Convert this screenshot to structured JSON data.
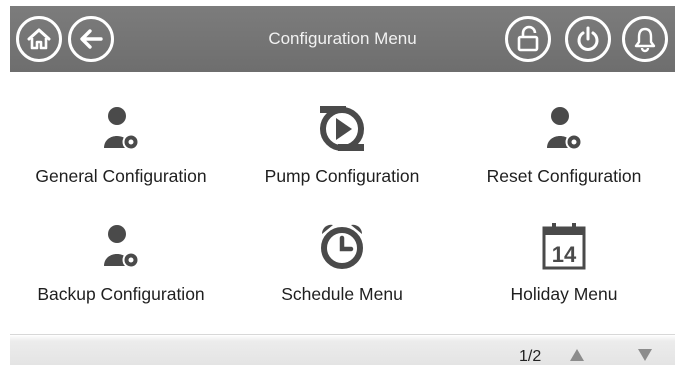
{
  "header": {
    "title": "Configuration Menu",
    "icons": {
      "home": "home-icon",
      "back": "back-arrow-icon",
      "lock": "unlock-icon",
      "power": "power-icon",
      "alarm": "bell-icon"
    }
  },
  "menu": {
    "items": [
      {
        "label": "General Configuration",
        "icon": "user-gear-icon"
      },
      {
        "label": "Pump Configuration",
        "icon": "pump-icon"
      },
      {
        "label": "Reset Configuration",
        "icon": "user-gear-icon"
      },
      {
        "label": "Backup Configuration",
        "icon": "user-gear-icon"
      },
      {
        "label": "Schedule Menu",
        "icon": "alarm-clock-icon"
      },
      {
        "label": "Holiday Menu",
        "icon": "calendar-icon",
        "calendar_day": "14"
      }
    ]
  },
  "footer": {
    "page_indicator": "1/2",
    "icons": {
      "up": "page-up-icon",
      "down": "page-down-icon"
    }
  },
  "colors": {
    "header_bg": "#747474",
    "icon_fill": "#4a4a4a",
    "arrow": "#8c8c8c"
  }
}
